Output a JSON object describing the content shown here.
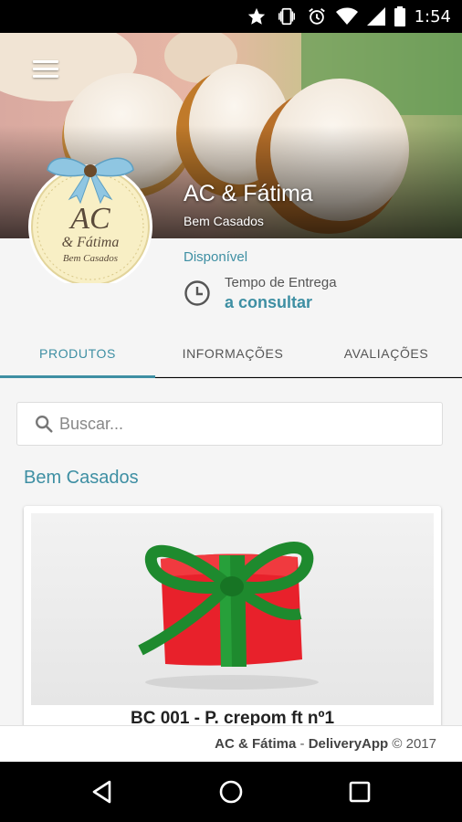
{
  "status_bar": {
    "time": "1:54",
    "icons": [
      "star-icon",
      "vibrate-icon",
      "alarm-icon",
      "wifi-icon",
      "signal-icon",
      "battery-icon"
    ]
  },
  "store": {
    "name": "AC & Fátima",
    "category": "Bem Casados",
    "logo_text_line1": "AC",
    "logo_text_line2": "& Fátima",
    "logo_text_line3": "Bem Casados",
    "status": "Disponível",
    "delivery_label": "Tempo de Entrega",
    "delivery_value": "a consultar"
  },
  "tabs": [
    {
      "label": "PRODUTOS",
      "active": true
    },
    {
      "label": "INFORMAÇÕES",
      "active": false
    },
    {
      "label": "AVALIAÇÕES",
      "active": false
    }
  ],
  "search": {
    "placeholder": "Buscar...",
    "value": ""
  },
  "section": {
    "title": "Bem Casados"
  },
  "products": [
    {
      "name": "BC 001 - P. crepom ft nº1"
    }
  ],
  "footer": {
    "brand": "AC & Fátima",
    "separator": " - ",
    "app": "DeliveryApp",
    "copyright": " © 2017"
  },
  "colors": {
    "accent": "#3e8fa3",
    "background": "#f5f5f5"
  }
}
